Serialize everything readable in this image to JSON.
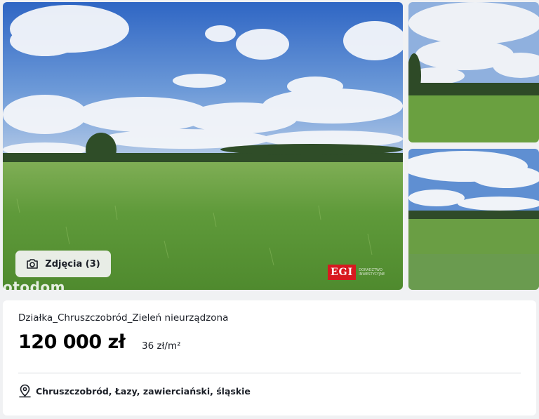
{
  "gallery": {
    "photos_button_label": "Zdjęcia (3)",
    "watermark": "otodom",
    "agency_logo_text": "EGI",
    "agency_logo_caption": "DORADZTWO INWESTYCYJNE",
    "camera_icon": "camera-icon",
    "colors": {
      "sky": "#3f74c9",
      "grass": "#5f9a3a",
      "logo_red": "#d7191f"
    }
  },
  "listing": {
    "title": "Działka_Chruszczobród_Zieleń nieurządzona",
    "price": "120 000 zł",
    "price_per_m2": "36 zł/m²",
    "location_icon": "map-pin-icon",
    "location": "Chruszczobród, Łazy, zawierciański, śląskie"
  }
}
